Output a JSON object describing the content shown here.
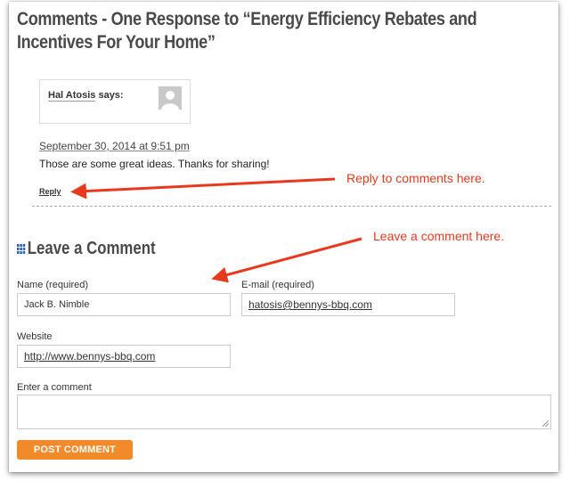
{
  "page": {
    "title": "Comments - One Response to “Energy Efficiency Rebates and Incentives For Your Home”"
  },
  "comment": {
    "author": "Hal Atosis",
    "says": "says:",
    "avatar_icon": "default-avatar-icon",
    "date": "September 30, 2014 at 9:51 pm",
    "text": "Those are some great ideas. Thanks for sharing!",
    "reply_label": "Reply"
  },
  "annotations": {
    "reply_note": "Reply to comments here.",
    "leave_note": "Leave a comment here.",
    "color": "#e8391d"
  },
  "form": {
    "heading": "Leave a Comment",
    "heading_icon": "grid-icon",
    "name_label": "Name (required)",
    "name_value": "Jack B. Nimble",
    "email_label": "E-mail (required)",
    "email_value": "hatosis@bennys-bbq.com",
    "website_label": "Website",
    "website_value": "http://www.bennys-bbq.com",
    "comment_label": "Enter a comment",
    "comment_value": "",
    "submit_label": "POST COMMENT",
    "submit_color": "#f28a2a"
  }
}
